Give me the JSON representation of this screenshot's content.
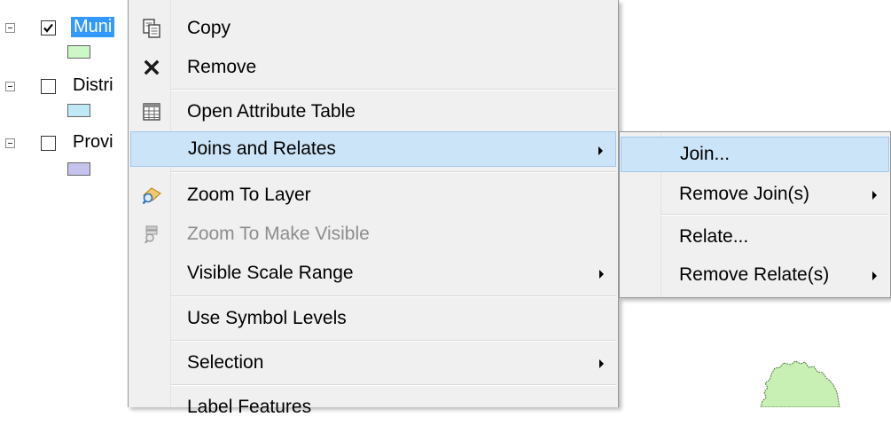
{
  "toc": {
    "layers": [
      {
        "name": "Muni",
        "checked": true,
        "selected": true,
        "swatch_color": "#ccf7c6"
      },
      {
        "name": "Distri",
        "checked": false,
        "selected": false,
        "swatch_color": "#bfe8f7"
      },
      {
        "name": "Provi",
        "checked": false,
        "selected": false,
        "swatch_color": "#c5c3ee"
      }
    ]
  },
  "context_menu": {
    "items": [
      {
        "label": "Copy",
        "icon": "copy-icon",
        "submenu": false,
        "enabled": true
      },
      {
        "label": "Remove",
        "icon": "remove-x-icon",
        "submenu": false,
        "enabled": true
      },
      {
        "label": "Open Attribute Table",
        "icon": "attribute-table-icon",
        "submenu": false,
        "enabled": true
      },
      {
        "label": "Joins and Relates",
        "icon": "",
        "submenu": true,
        "enabled": true,
        "highlighted": true
      },
      {
        "label": "Zoom To Layer",
        "icon": "zoom-to-layer-icon",
        "submenu": false,
        "enabled": true
      },
      {
        "label": "Zoom To Make Visible",
        "icon": "zoom-to-make-visible-icon",
        "submenu": false,
        "enabled": false
      },
      {
        "label": "Visible Scale Range",
        "icon": "",
        "submenu": true,
        "enabled": true
      },
      {
        "label": "Use Symbol Levels",
        "icon": "",
        "submenu": false,
        "enabled": true
      },
      {
        "label": "Selection",
        "icon": "",
        "submenu": true,
        "enabled": true
      },
      {
        "label": "Label Features",
        "icon": "",
        "submenu": false,
        "enabled": true
      }
    ]
  },
  "joins_submenu": {
    "items": [
      {
        "label": "Join...",
        "submenu": false,
        "highlighted": true
      },
      {
        "label": "Remove Join(s)",
        "submenu": true
      },
      {
        "label": "Relate...",
        "submenu": false
      },
      {
        "label": "Remove Relate(s)",
        "submenu": true
      }
    ]
  },
  "colors": {
    "selection_blue": "#3399ff",
    "menu_background": "#f0f0f0",
    "hover_fill": "#cce4f7",
    "hover_border": "#9ec8ec",
    "map_feature_fill": "#c8f0b4",
    "map_feature_stroke": "#4a7a3a"
  }
}
